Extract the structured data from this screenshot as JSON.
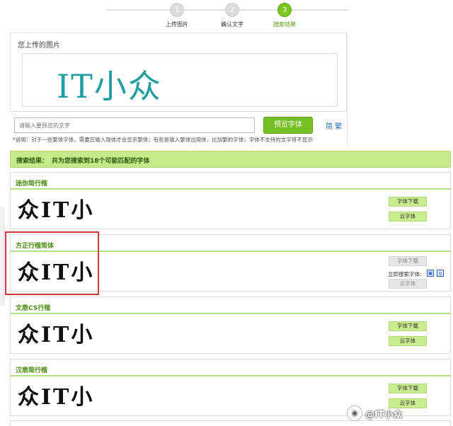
{
  "steps": [
    {
      "number": "1",
      "label": "上传图片"
    },
    {
      "number": "2",
      "label": "确认文字"
    },
    {
      "number": "3",
      "label": "搜索结果"
    }
  ],
  "upload": {
    "title": "您上传的图片",
    "preview_text": "IT小众"
  },
  "search": {
    "placeholder": "请输入要预览的文字",
    "preview_button": "预览字体",
    "lang_toggle": "简 繁",
    "note": "*说明：对于一些繁体字体，需要您输入简体才会显示繁体；有些是输入繁体出简体，比加繁的字体；字体不支持的文字将不显示"
  },
  "summary": {
    "label": "搜索结果：",
    "text": "共为您搜索到18个可能匹配的字体"
  },
  "results": [
    {
      "name": "迷你简行楷",
      "sample": "众IT小",
      "download": "字体下载",
      "cloud": "云字体",
      "disabled": false
    },
    {
      "name": "方正行楷简体",
      "sample": "众IT小",
      "download": "字体下载",
      "cloud": "云字体",
      "disabled": true,
      "instant_search": "立即搜索字体:"
    },
    {
      "name": "文鼎CS行楷",
      "sample": "众IT小",
      "download": "字体下载",
      "cloud": "云字体",
      "disabled": false
    },
    {
      "name": "汉鼎简行楷",
      "sample": "众IT小",
      "download": "字体下载",
      "cloud": "云字体",
      "disabled": false
    }
  ],
  "watermark": {
    "text": "@IT小众"
  },
  "colors": {
    "accent": "#74bf23",
    "highlight": "#d53a3a",
    "summary_bg": "#c6e98a"
  }
}
